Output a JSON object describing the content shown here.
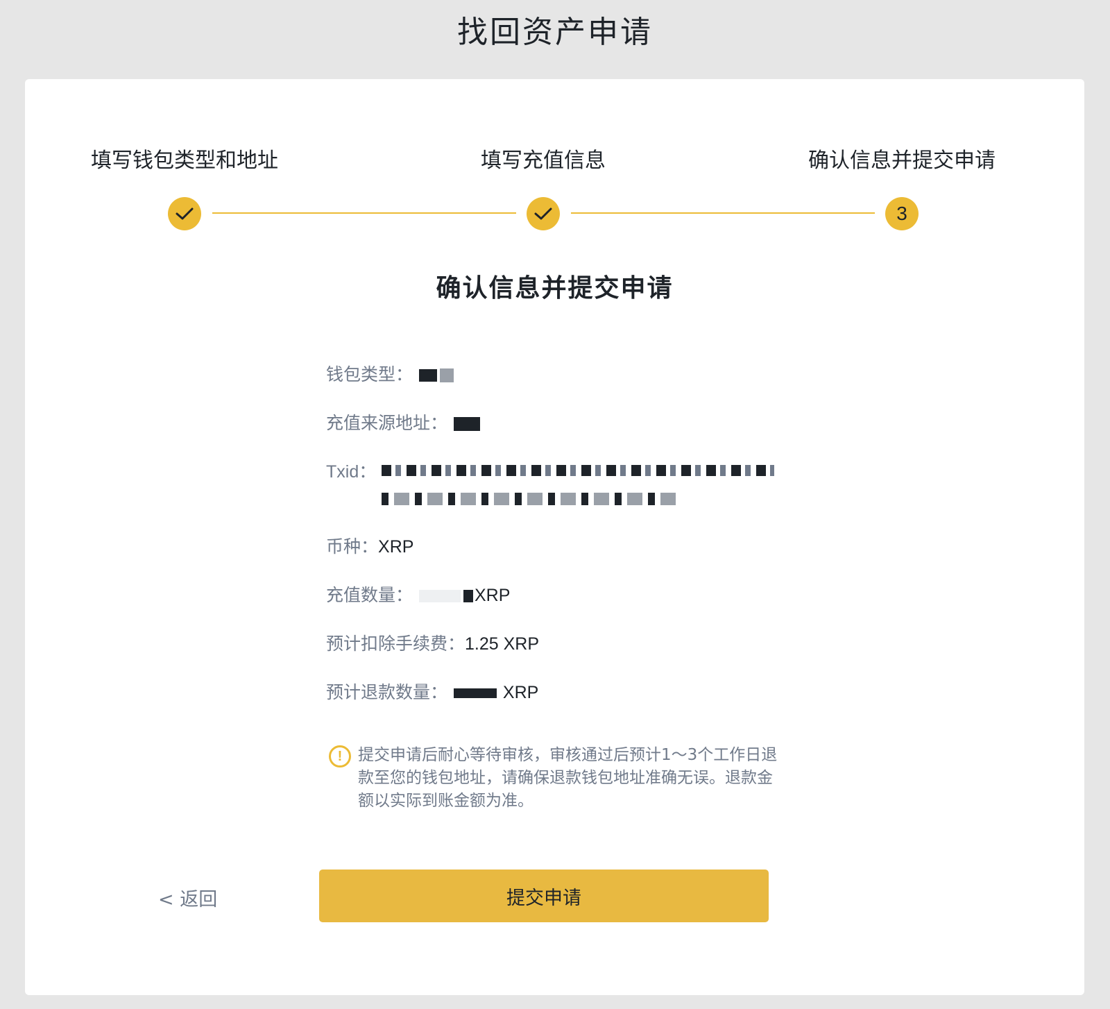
{
  "page_title": "找回资产申请",
  "steps": [
    {
      "label": "填写钱包类型和地址",
      "status": "done",
      "marker": "✓"
    },
    {
      "label": "填写充值信息",
      "status": "done",
      "marker": "✓"
    },
    {
      "label": "确认信息并提交申请",
      "status": "current",
      "marker": "3"
    }
  ],
  "section_title": "确认信息并提交申请",
  "details": {
    "wallet_type": {
      "label": "钱包类型：",
      "value": ""
    },
    "source_address": {
      "label": "充值来源地址：",
      "value": ""
    },
    "txid": {
      "label": "Txid：",
      "value": ""
    },
    "coin": {
      "label": "币种：",
      "value": "XRP"
    },
    "deposit_amount": {
      "label": "充值数量：",
      "value": "",
      "unit": "XRP"
    },
    "estimated_fee": {
      "label": "预计扣除手续费：",
      "value": "1.25 XRP"
    },
    "estimated_refund": {
      "label": "预计退款数量：",
      "value": "",
      "unit": "XRP"
    }
  },
  "notice": {
    "icon": "exclamation-circle-icon",
    "text": "提交申请后耐心等待审核，审核通过后预计1～3个工作日退款至您的钱包地址，请确保退款钱包地址准确无误。退款金额以实际到账金额为准。"
  },
  "actions": {
    "back_label": "< 返回",
    "submit_label": "提交申请"
  },
  "colors": {
    "accent": "#ecbb35",
    "button": "#e8b941",
    "background": "#e6e6e6",
    "label_grey": "#707a8a",
    "text_dark": "#1e2329"
  }
}
